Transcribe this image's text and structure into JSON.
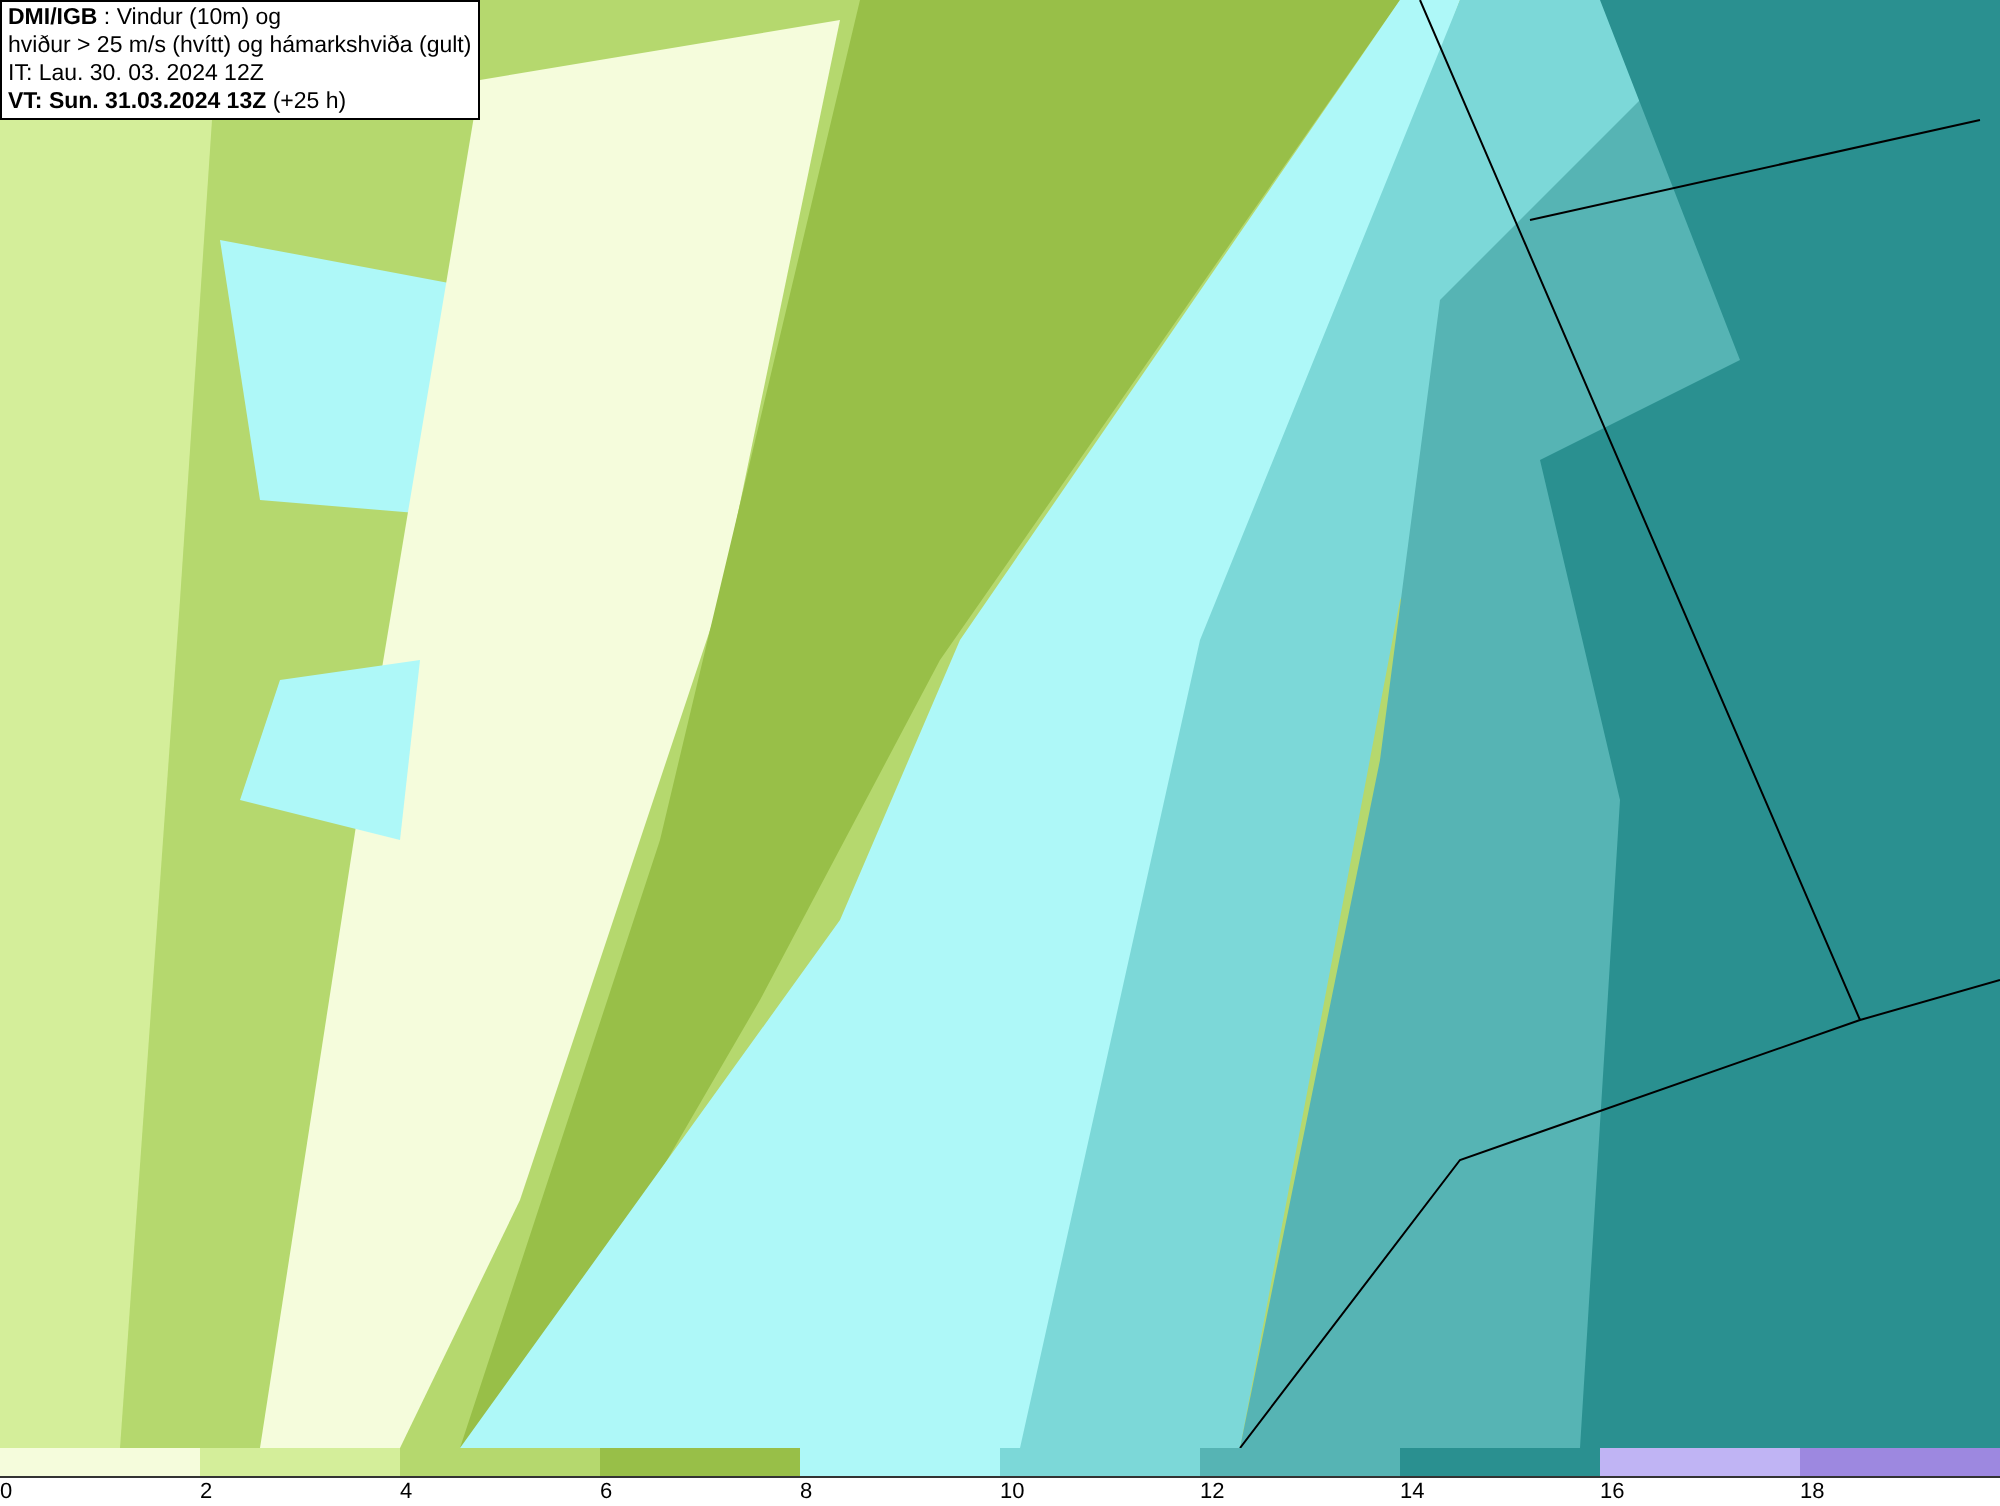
{
  "title_box": {
    "lines": [
      "**DMI/IGB** : Vindur (10m) og",
      "hviður > 25 m/s (hvítt) og hámarkshviða (gult)",
      "IT: Lau. 30. 03. 2024 12Z",
      "**VT: Sun. 31.03.2024 13Z** (+25 h)"
    ]
  },
  "legend": {
    "bins": [
      {
        "color": "#f5fcdc",
        "label": "0"
      },
      {
        "color": "#d4ee9a",
        "label": "2"
      },
      {
        "color": "#b5d86e",
        "label": "4"
      },
      {
        "color": "#98bf48",
        "label": "6"
      },
      {
        "color": "#aef8f8",
        "label": "8"
      },
      {
        "color": "#7cd8d8",
        "label": "10"
      },
      {
        "color": "#56b4b4",
        "label": "12"
      },
      {
        "color": "#2a9090",
        "label": "14"
      },
      {
        "color": "#c0b4f4",
        "label": "16"
      },
      {
        "color": "#9d88e0",
        "label": "18"
      }
    ]
  }
}
